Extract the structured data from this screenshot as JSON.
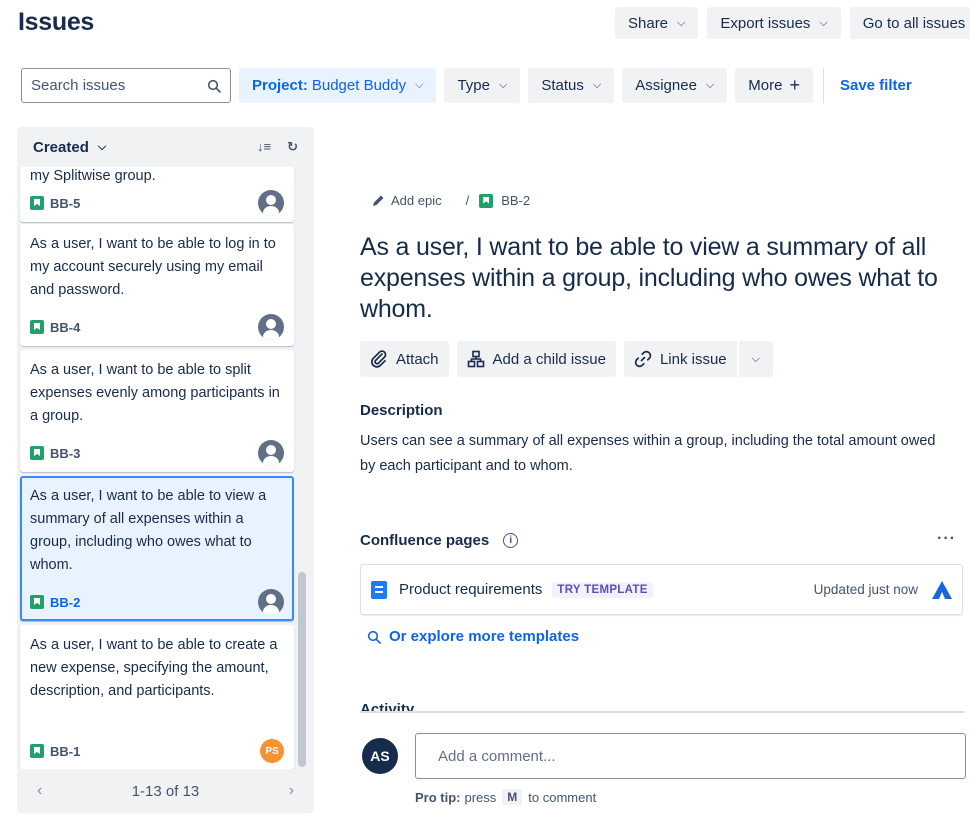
{
  "page": {
    "title": "Issues"
  },
  "top_actions": {
    "share": "Share",
    "export": "Export issues",
    "go_all": "Go to all issues"
  },
  "filters": {
    "search_placeholder": "Search issues",
    "project_key": "Project:",
    "project_value": "Budget Buddy",
    "type": "Type",
    "status": "Status",
    "assignee": "Assignee",
    "more": "More",
    "save_filter": "Save filter"
  },
  "sidebar": {
    "sort_label": "Created",
    "cards": [
      {
        "text": "my Splitwise group.",
        "key": "BB-5",
        "assignee": "anonymous"
      },
      {
        "text": "As a user, I want to be able to log in to my account securely using my email and password.",
        "key": "BB-4",
        "assignee": "anonymous"
      },
      {
        "text": "As a user, I want to be able to split expenses evenly among participants in a group.",
        "key": "BB-3",
        "assignee": "anonymous"
      },
      {
        "text": "As a user, I want to be able to view a summary of all expenses within a group, including who owes what to whom.",
        "key": "BB-2",
        "assignee": "anonymous"
      },
      {
        "text": "As a user, I want to be able to create a new expense, specifying the amount, description, and participants.",
        "key": "BB-1",
        "assignee": "PS"
      }
    ],
    "pager": "1-13 of 13"
  },
  "issue": {
    "add_epic": "Add epic",
    "separator": "/",
    "key": "BB-2",
    "title": "As a user, I want to be able to view a summary of all expenses within a group, including who owes what to whom.",
    "actions": {
      "attach": "Attach",
      "child": "Add a child issue",
      "link": "Link issue"
    },
    "description_heading": "Description",
    "description": "Users can see a summary of all expenses within a group, including the total amount owed by each participant and to whom.",
    "confluence_heading": "Confluence pages",
    "template": {
      "name": "Product requirements",
      "lozenge": "TRY TEMPLATE",
      "updated": "Updated just now"
    },
    "explore": "Or explore more templates",
    "activity_heading": "Activity",
    "comment": {
      "avatar": "AS",
      "placeholder": "Add a comment...",
      "tip_label": "Pro tip:",
      "tip_pre": "press",
      "tip_key": "M",
      "tip_post": "to comment"
    }
  },
  "colors": {
    "accent": "#0c66e4",
    "story": "#22a06b",
    "selected_bg": "#e9f2ff",
    "selected_border": "#388bff",
    "avatar_ps": "#f79232"
  }
}
